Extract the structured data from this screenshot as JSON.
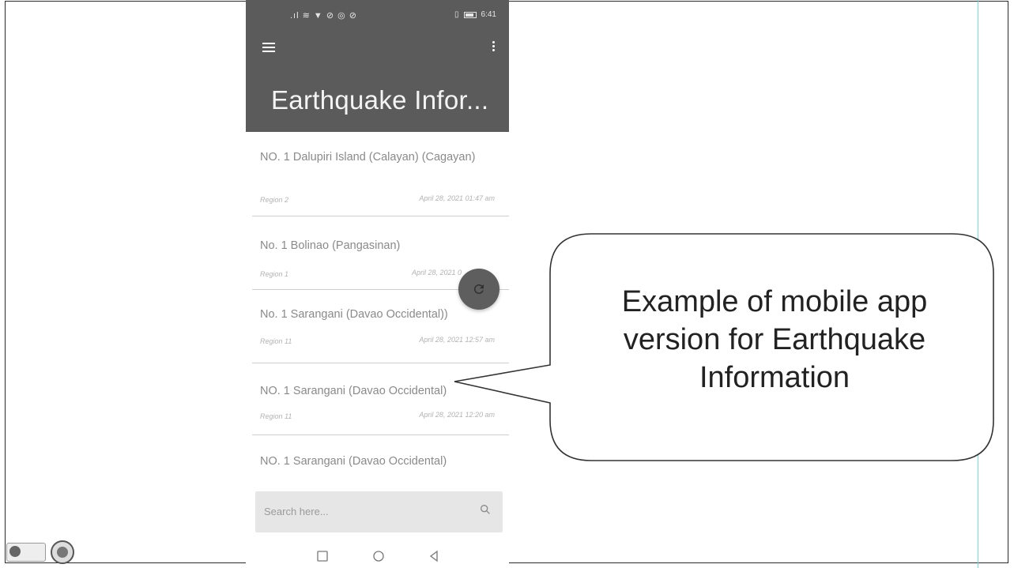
{
  "status_bar": {
    "left_icons": ".ıl ≋ ▼ ⊘ ◎ ⊘",
    "right_text": "6:41"
  },
  "app": {
    "title": "Earthquake Infor..."
  },
  "items": [
    {
      "title": "NO. 1 Dalupiri Island (Calayan) (Cagayan)",
      "region": "Region 2",
      "date": "April 28, 2021 01:47 am"
    },
    {
      "title": "No. 1 Bolinao (Pangasinan)",
      "region": "Region 1",
      "date": "April 28, 2021 0"
    },
    {
      "title": "No. 1 Sarangani (Davao Occidental))",
      "region": "Region 11",
      "date": "April 28, 2021 12:57 am"
    },
    {
      "title": "NO. 1 Sarangani (Davao Occidental)",
      "region": "Region 11",
      "date": "April 28, 2021 12:20 am"
    },
    {
      "title": "NO. 1 Sarangani (Davao Occidental)",
      "region": "",
      "date": ""
    }
  ],
  "search": {
    "placeholder": "Search here..."
  },
  "callout": {
    "lines": [
      "Example of mobile app",
      "version for Earthquake",
      "Information"
    ]
  },
  "icons": {
    "menu": "hamburger-menu-icon",
    "overflow": "more-vert-icon",
    "refresh": "refresh-icon",
    "search": "search-icon",
    "recent": "square-nav-icon",
    "home": "circle-nav-icon",
    "back": "triangle-back-nav-icon"
  },
  "colors": {
    "appbar": "#5b5b5b",
    "fab": "#5e5e5e",
    "searchbar": "#e6e6e6"
  }
}
